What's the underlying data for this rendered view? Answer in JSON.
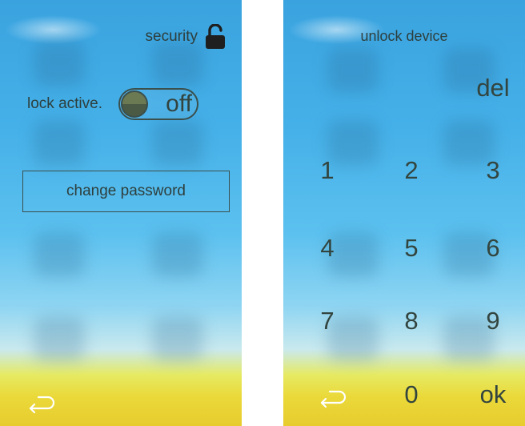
{
  "security_screen": {
    "title": "security",
    "title_icon": "unlocked-padlock-icon",
    "lock_label": "lock active.",
    "lock_toggle_state": "off",
    "change_password_label": "change password",
    "back_icon": "return-arrow-icon"
  },
  "unlock_screen": {
    "title": "unlock device",
    "delete_label": "del",
    "keys": [
      "1",
      "2",
      "3",
      "4",
      "5",
      "6",
      "7",
      "8",
      "9",
      "0"
    ],
    "ok_label": "ok",
    "back_icon": "return-arrow-icon"
  },
  "colors": {
    "text": "#2e3f3d",
    "sky_top": "#3aa3df",
    "sky_mid": "#8fd5f2",
    "ground": "#e8cc2e"
  }
}
